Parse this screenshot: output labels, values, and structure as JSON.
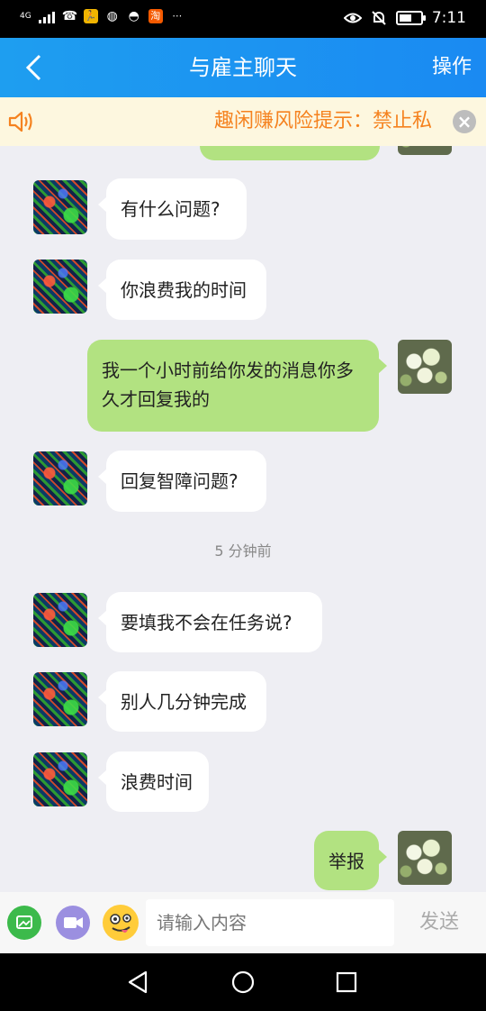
{
  "status_bar": {
    "network": "4G",
    "time": "7:11",
    "icons": [
      "signal-bars-icon",
      "missed-call-icon",
      "running-app-icon",
      "wechat-icon",
      "qq-icon",
      "taobao-icon",
      "more-dots-icon",
      "eye-icon",
      "silent-bell-icon",
      "battery-icon"
    ]
  },
  "header": {
    "title": "与雇主聊天",
    "action_label": "操作",
    "back_icon": "chevron-left-icon"
  },
  "banner": {
    "text": "趣闲赚风险提示：禁止私",
    "close_label": "×",
    "speaker_icon": "speaker-icon"
  },
  "messages": [
    {
      "side": "in",
      "text": "有什么问题?"
    },
    {
      "side": "in",
      "text": "你浪费我的时间"
    },
    {
      "side": "out",
      "text": "我一个小时前给你发的消息你多久才回复我的"
    },
    {
      "side": "in",
      "text": "回复智障问题?"
    },
    {
      "side": "in",
      "text": "要填我不会在任务说?"
    },
    {
      "side": "in",
      "text": "别人几分钟完成"
    },
    {
      "side": "in",
      "text": "浪费时间"
    },
    {
      "side": "out",
      "text": "举报"
    }
  ],
  "timestamp": "5 分钟前",
  "input_bar": {
    "placeholder": "请输入内容",
    "send_label": "发送"
  },
  "colors": {
    "header_blue": "#1a8af2",
    "chat_bg": "#eeeef3",
    "out_bubble": "#b2e281",
    "banner_text": "#f5821f"
  }
}
